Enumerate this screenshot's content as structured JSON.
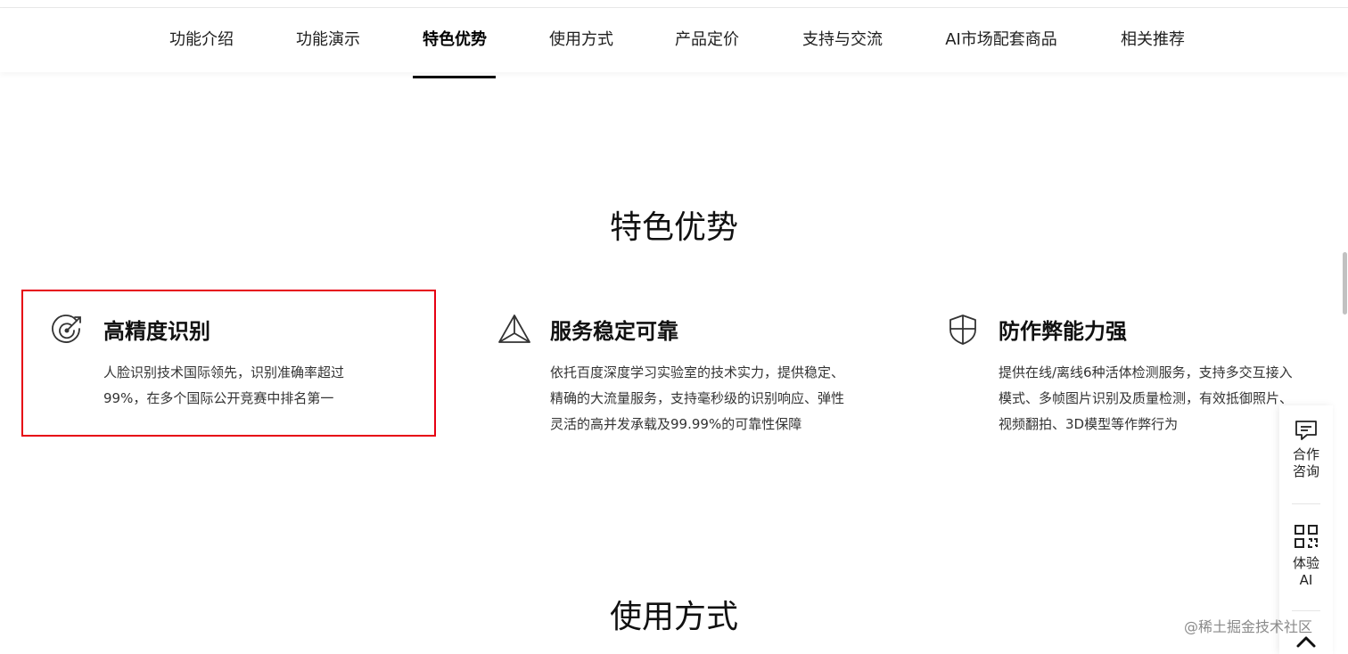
{
  "nav": {
    "items": [
      {
        "label": "功能介绍",
        "active": false
      },
      {
        "label": "功能演示",
        "active": false
      },
      {
        "label": "特色优势",
        "active": true
      },
      {
        "label": "使用方式",
        "active": false
      },
      {
        "label": "产品定价",
        "active": false
      },
      {
        "label": "支持与交流",
        "active": false
      },
      {
        "label": "AI市场配套商品",
        "active": false
      },
      {
        "label": "相关推荐",
        "active": false
      }
    ]
  },
  "advantages": {
    "title": "特色优势",
    "features": [
      {
        "icon": "target-icon",
        "title": "高精度识别",
        "desc": "人脸识别技术国际领先，识别准确率超过99%，在多个国际公开竞赛中排名第一"
      },
      {
        "icon": "stable-icon",
        "title": "服务稳定可靠",
        "desc": "依托百度深度学习实验室的技术实力，提供稳定、精确的大流量服务，支持毫秒级的识别响应、弹性灵活的高并发承载及99.99%的可靠性保障"
      },
      {
        "icon": "shield-icon",
        "title": "防作弊能力强",
        "desc": "提供在线/离线6种活体检测服务，支持多交互接入模式、多帧图片识别及质量检测，有效抵御照片、视频翻拍、3D模型等作弊行为"
      }
    ]
  },
  "usage": {
    "title": "使用方式"
  },
  "float_panel": {
    "consult_label": "合作咨询",
    "try_label": "体验AI"
  },
  "watermark": "@稀土掘金技术社区",
  "colors": {
    "highlight_border": "#e60012",
    "nav_active": "#000000"
  }
}
